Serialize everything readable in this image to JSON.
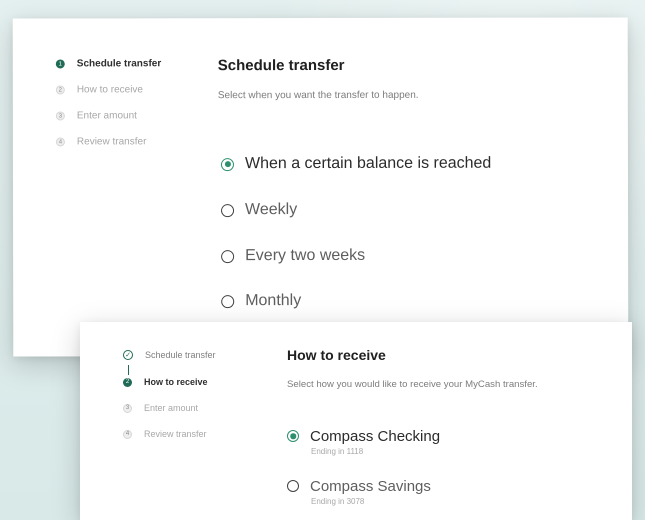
{
  "back_card": {
    "steps": [
      {
        "label": "Schedule transfer",
        "state": "active",
        "marker": "1"
      },
      {
        "label": "How to receive",
        "state": "inactive",
        "marker": "2"
      },
      {
        "label": "Enter amount",
        "state": "inactive",
        "marker": "3"
      },
      {
        "label": "Review transfer",
        "state": "inactive",
        "marker": "4"
      }
    ],
    "title": "Schedule transfer",
    "subtitle": "Select when you want the transfer to happen.",
    "options": [
      {
        "label": "When a certain balance is reached",
        "selected": true
      },
      {
        "label": "Weekly",
        "selected": false
      },
      {
        "label": "Every two weeks",
        "selected": false
      },
      {
        "label": "Monthly",
        "selected": false
      }
    ]
  },
  "front_card": {
    "steps": [
      {
        "label": "Schedule transfer",
        "state": "done",
        "marker": "✓"
      },
      {
        "label": "How to receive",
        "state": "active",
        "marker": "2"
      },
      {
        "label": "Enter amount",
        "state": "inactive",
        "marker": "3"
      },
      {
        "label": "Review transfer",
        "state": "inactive",
        "marker": "4"
      }
    ],
    "title": "How to receive",
    "subtitle": "Select how you would like to receive your MyCash transfer.",
    "options": [
      {
        "label": "Compass Checking",
        "detail": "Ending in 1118",
        "selected": true
      },
      {
        "label": "Compass Savings",
        "detail": "Ending in 3078",
        "selected": false
      }
    ]
  },
  "colors": {
    "background": "#ddeceb",
    "accent": "#2d8f6e",
    "step_active": "#1f6b55",
    "card": "#ffffff"
  }
}
